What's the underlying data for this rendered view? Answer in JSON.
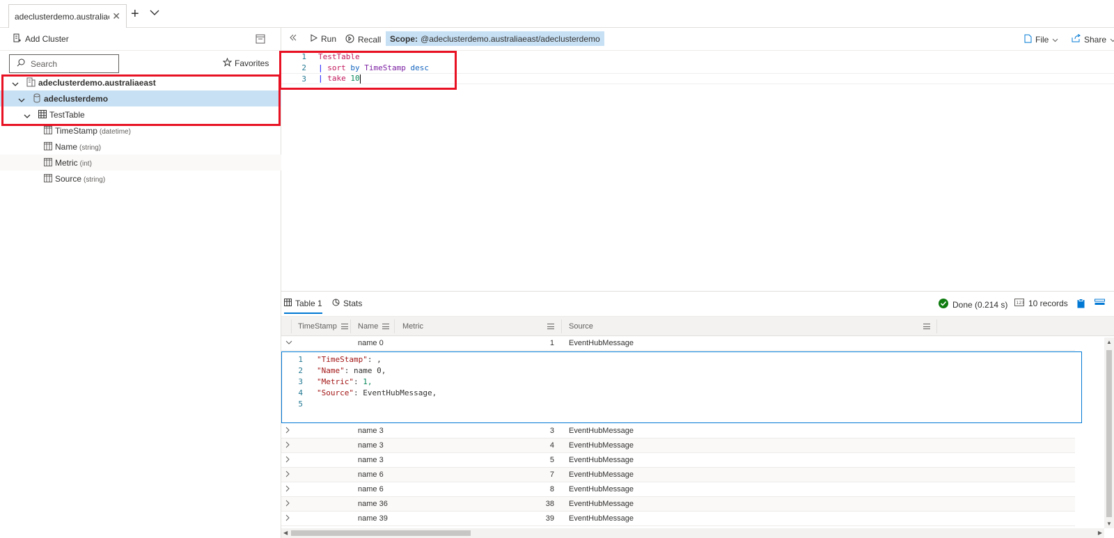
{
  "browser_tab": {
    "title": "adeclusterdemo.australiaea"
  },
  "left_panel": {
    "add_cluster_label": "Add Cluster",
    "search_placeholder": "Search",
    "favorites_label": "Favorites",
    "tree": {
      "cluster": "adeclusterdemo.australiaeast",
      "database": "adeclusterdemo",
      "table": "TestTable",
      "columns": [
        {
          "name": "TimeStamp",
          "type": "(datetime)"
        },
        {
          "name": "Name",
          "type": "(string)"
        },
        {
          "name": "Metric",
          "type": "(int)"
        },
        {
          "name": "Source",
          "type": "(string)"
        }
      ]
    }
  },
  "toolbar": {
    "run_label": "Run",
    "recall_label": "Recall",
    "scope_label": "Scope:",
    "scope_value": "@adeclusterdemo.australiaeast/adeclusterdemo",
    "file_label": "File",
    "share_label": "Share"
  },
  "editor": {
    "lines": [
      {
        "num": "1",
        "parts": [
          "TestTable"
        ]
      },
      {
        "num": "2",
        "parts": [
          "|",
          "sort",
          "by",
          "TimeStamp",
          "desc"
        ]
      },
      {
        "num": "3",
        "parts": [
          "|",
          "take",
          "10"
        ]
      }
    ]
  },
  "results": {
    "tabs": [
      "Table 1",
      "Stats"
    ],
    "status": "Done (0.214 s)",
    "records": "10 records",
    "columns": [
      "TimeStamp",
      "Name",
      "Metric",
      "Source"
    ],
    "expanded_row": {
      "name": "name 0",
      "metric": "1",
      "source": "EventHubMessage"
    },
    "json_lines": [
      {
        "num": "1",
        "key": "\"TimeStamp\"",
        "sep": ": ",
        "value": ","
      },
      {
        "num": "2",
        "key": "\"Name\"",
        "sep": ": ",
        "value": "name 0,"
      },
      {
        "num": "3",
        "key": "\"Metric\"",
        "sep": ": ",
        "value": "1,"
      },
      {
        "num": "4",
        "key": "\"Source\"",
        "sep": ": ",
        "value": "EventHubMessage,"
      },
      {
        "num": "5",
        "key": "",
        "sep": "",
        "value": ""
      }
    ],
    "rows": [
      {
        "name": "name 3",
        "metric": "3",
        "source": "EventHubMessage"
      },
      {
        "name": "name 3",
        "metric": "4",
        "source": "EventHubMessage"
      },
      {
        "name": "name 3",
        "metric": "5",
        "source": "EventHubMessage"
      },
      {
        "name": "name 6",
        "metric": "7",
        "source": "EventHubMessage"
      },
      {
        "name": "name 6",
        "metric": "8",
        "source": "EventHubMessage"
      },
      {
        "name": "name 36",
        "metric": "38",
        "source": "EventHubMessage"
      },
      {
        "name": "name 39",
        "metric": "39",
        "source": "EventHubMessage"
      }
    ]
  },
  "colors": {
    "highlight": "#e81123",
    "selection": "#c7e0f4",
    "accent": "#0078d4",
    "success": "#107c10"
  }
}
